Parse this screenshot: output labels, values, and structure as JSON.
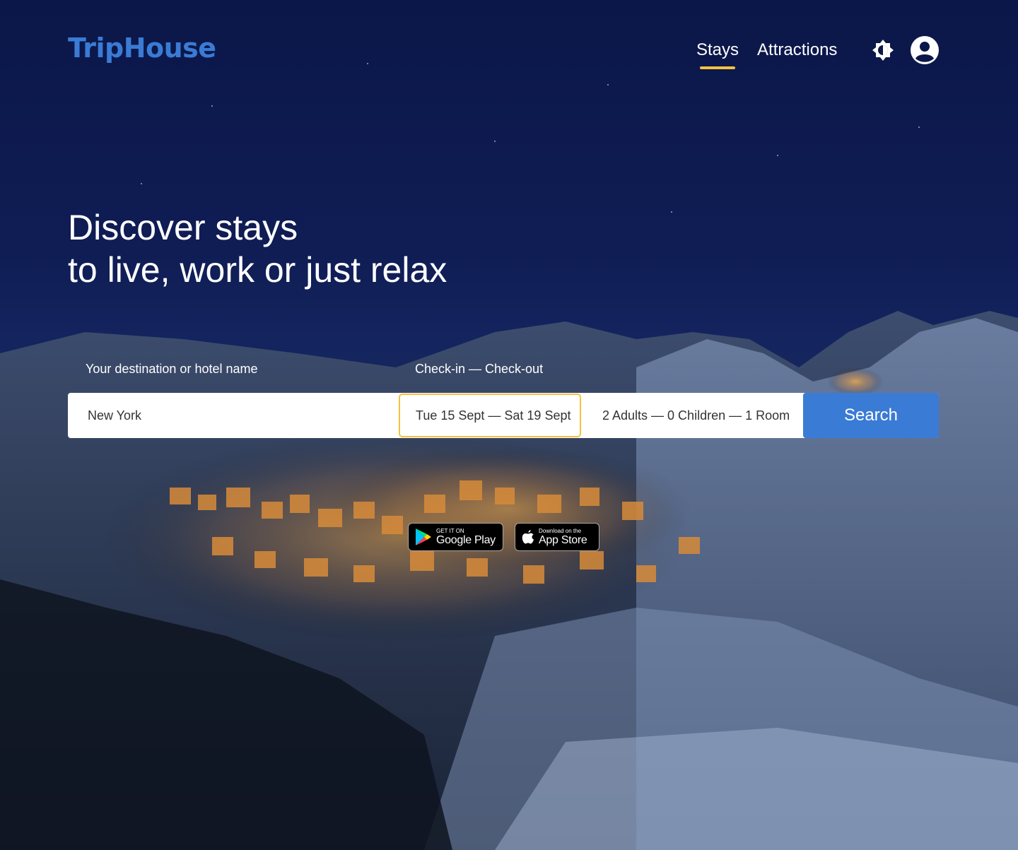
{
  "header": {
    "logo": "TripHouse",
    "nav": [
      {
        "label": "Stays",
        "active": true
      },
      {
        "label": "Attractions",
        "active": false
      }
    ],
    "icons": {
      "theme_toggle": "brightness-icon",
      "account": "user-circle-icon"
    }
  },
  "hero": {
    "line1": "Discover stays",
    "line2": "to live, work or just relax"
  },
  "search": {
    "destination_label": "Your destination or hotel name",
    "destination_value": "New York",
    "dates_label": "Check-in — Check-out",
    "dates_value": "Tue 15 Sept — Sat 19 Sept",
    "guests_value": "2 Adults — 0 Children — 1 Room",
    "button_label": "Search"
  },
  "badges": {
    "google_small": "GET IT ON",
    "google_big": "Google Play",
    "apple_small": "Download on the",
    "apple_big": "App Store"
  },
  "colors": {
    "brand": "#3a7bd5",
    "accent": "#f6c23e",
    "background": "#0d1a4a"
  }
}
